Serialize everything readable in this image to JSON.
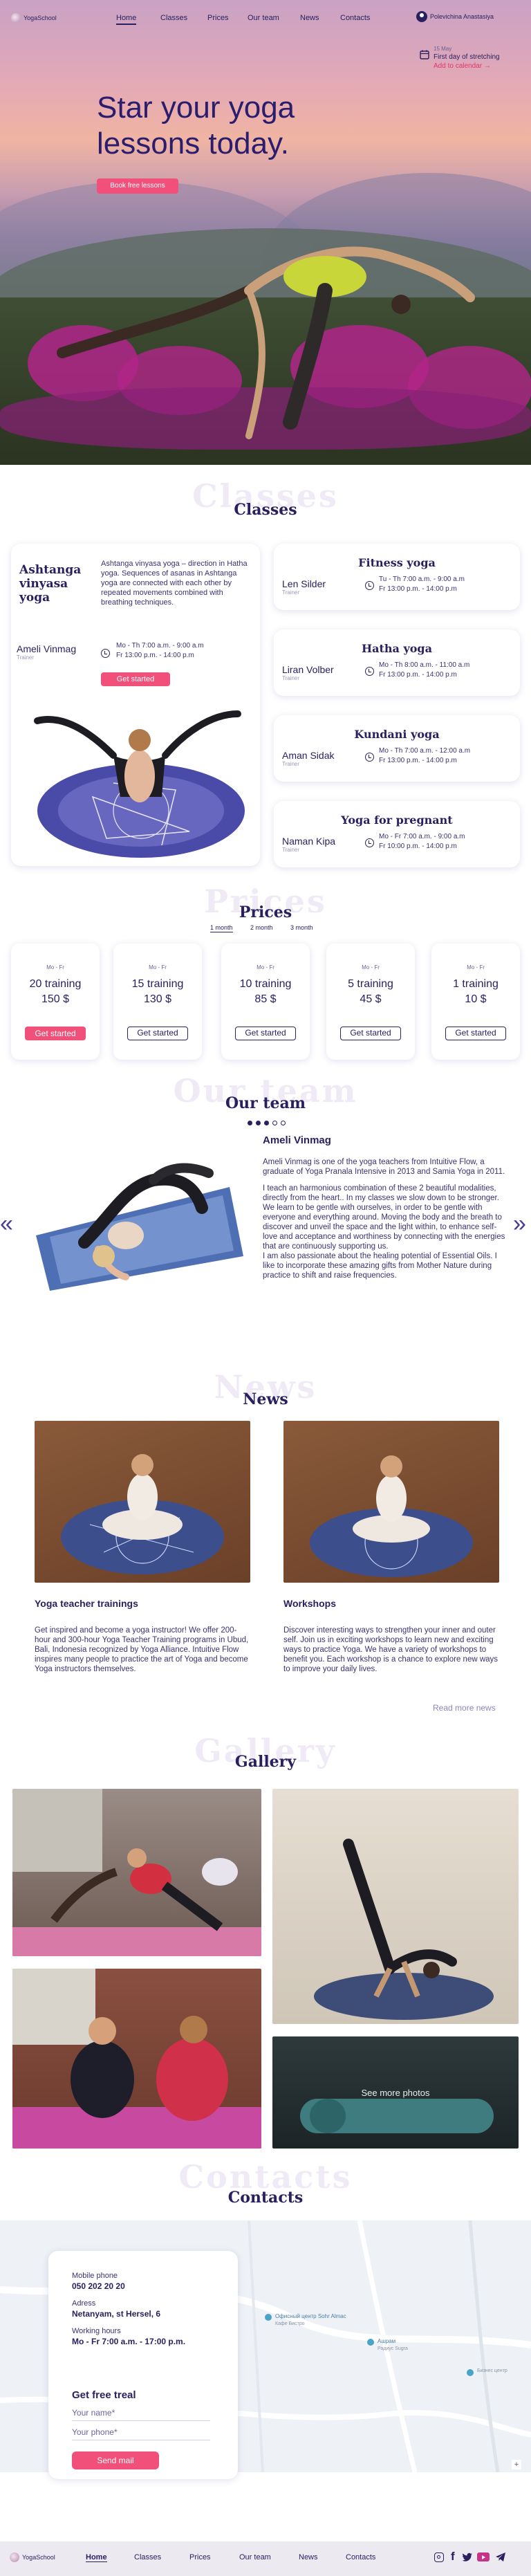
{
  "brand": {
    "name": "YogaSchool"
  },
  "nav": {
    "items": [
      "Home",
      "Classes",
      "Prices",
      "Our team",
      "News",
      "Contacts"
    ],
    "user": "Polevichina Anastasiya"
  },
  "event": {
    "date": "15 May",
    "title": "First day of stretching",
    "link": "Add to calendar →"
  },
  "hero": {
    "title_line1": "Star your yoga",
    "title_line2": "lessons today.",
    "button": "Book free lessons"
  },
  "classes": {
    "ghost": "Classes",
    "title": "Classes",
    "featured": {
      "name": "Ashtanga vinyasa yoga",
      "description": "Ashtanga vinyasa yoga – direction in Hatha yoga. Sequences of asanas in Ashtanga yoga are connected with each other by repeated movements combined with breathing techniques.",
      "trainer": "Ameli Vinmag",
      "role": "Trainer",
      "time1": "Mo - Th  7:00 a.m. - 9:00 a.m",
      "time2": "Fr  13:00 p.m. - 14:00 p.m",
      "button": "Get started"
    },
    "list": [
      {
        "name": "Fitness yoga",
        "trainer": "Len Silder",
        "role": "Trainer",
        "time1": "Tu - Th  7:00 a.m. - 9:00 a.m",
        "time2": "Fr  13:00 p.m. - 14:00 p.m"
      },
      {
        "name": "Hatha yoga",
        "trainer": "Liran Volber",
        "role": "Trainer",
        "time1": "Mo - Th  8:00 a.m. - 11:00 a.m",
        "time2": "Fr  13:00 p.m. - 14:00 p.m"
      },
      {
        "name": "Kundani yoga",
        "trainer": "Aman Sidak",
        "role": "Trainer",
        "time1": "Mo - Th  7:00 a.m. - 12:00 a.m",
        "time2": "Fr  13:00 p.m. - 14:00 p.m"
      },
      {
        "name": "Yoga for pregnant",
        "trainer": "Naman Kipa",
        "role": "Trainer",
        "time1": "Mo - Fr  7:00 a.m. - 9:00 a.m",
        "time2": "Fr  10:00 p.m. - 14:00 p.m"
      }
    ]
  },
  "prices": {
    "ghost": "Prices",
    "title": "Prices",
    "tabs": [
      "1 month",
      "2 month",
      "3 month"
    ],
    "days": "Mo - Fr",
    "plans": [
      {
        "count": "20 training",
        "price": "150 $",
        "button": "Get started"
      },
      {
        "count": "15 training",
        "price": "130 $",
        "button": "Get started"
      },
      {
        "count": "10 training",
        "price": "85 $",
        "button": "Get started"
      },
      {
        "count": "5 training",
        "price": "45 $",
        "button": "Get started"
      },
      {
        "count": "1 training",
        "price": "10 $",
        "button": "Get started"
      }
    ]
  },
  "team": {
    "ghost": "Our team",
    "title": "Our team",
    "name": "Ameli Vinmag",
    "bio1": "Ameli Vinmag is one of the yoga teachers from Intuitive Flow, a graduate of Yoga Pranala Intensive in 2013 and Samia Yoga in 2011.",
    "bio2": "I teach an harmonious combination of these 2 beautiful modalities, directly from the heart.. In my classes we slow down to be stronger. We learn to be gentle with ourselves, in order to be gentle with everyone and everything around. Moving the body and the breath to discover and unveil the space and the light within, to enhance self-love and acceptance and worthiness by connecting with the energies that are continuously supporting us.",
    "bio3": "I am also passionate about the healing potential of Essential Oils. I like to incorporate these amazing gifts from Mother Nature during practice to shift and raise frequencies."
  },
  "news": {
    "ghost": "News",
    "title": "News",
    "items": [
      {
        "title": "Yoga teacher trainings",
        "text": "Get inspired and become a yoga instructor! We offer 200-hour and 300-hour Yoga Teacher Training programs in Ubud, Bali, Indonesia recognized by Yoga Alliance. Intuitive Flow inspires many people to practice the art of Yoga and become Yoga instructors themselves."
      },
      {
        "title": "Workshops",
        "text": "Discover interesting ways to strengthen your inner and outer self. Join us in exciting workshops to learn new and exciting ways to practice Yoga. We have a variety of workshops to benefit you. Each workshop is a chance to explore new ways to improve your daily lives."
      }
    ],
    "more": "Read more news"
  },
  "gallery": {
    "ghost": "Gallery",
    "title": "Gallery",
    "more": "See more photos"
  },
  "contacts": {
    "ghost": "Contacts",
    "title": "Contacts",
    "phone_label": "Mobile phone",
    "phone": "050 202 20 20",
    "address_label": "Adress",
    "address": "Netanyam, st Hersel, 6",
    "hours_label": "Working hours",
    "hours": "Mo - Fr  7:00 a.m. - 17:00 p.m.",
    "form_title": "Get free treal",
    "name_placeholder": "Your name*",
    "phone_placeholder": "Your phone*",
    "button": "Send mail",
    "map_labels": [
      "Офисный центр Sohr Almac",
      "Кафе Бистро",
      "Ашрам",
      "Радиус Sugra",
      "Бизнес центр"
    ]
  },
  "footer": {
    "brand": "YogaSchool",
    "items": [
      "Home",
      "Classes",
      "Prices",
      "Our team",
      "News",
      "Contacts"
    ],
    "social": [
      "instagram-icon",
      "facebook-icon",
      "twitter-icon",
      "youtube-icon",
      "telegram-icon"
    ]
  },
  "colors": {
    "accent": "#f0507a",
    "primary": "#2a2060",
    "ghost": "#efeaf6"
  }
}
